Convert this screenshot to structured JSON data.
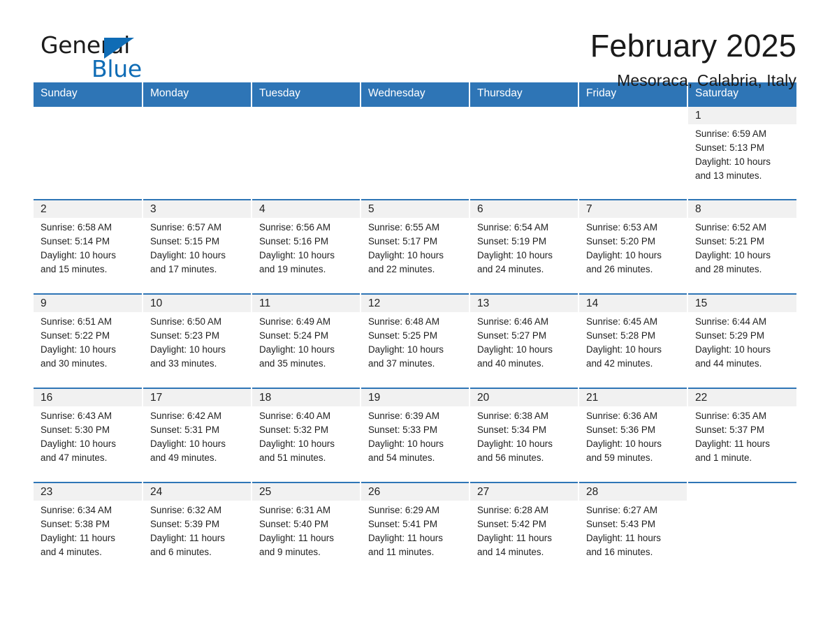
{
  "brand": {
    "word_one": "General",
    "word_two": "Blue",
    "accent_color": "#0f6cb5",
    "triangle_icon": "triangle-icon"
  },
  "header": {
    "title": "February 2025",
    "location": "Mesoraca, Calabria, Italy"
  },
  "theme": {
    "header_blue": "#2e75b6",
    "daynum_band": "#f1f1f1",
    "text": "#1f1f1f"
  },
  "calendar": {
    "weekday_headers": [
      "Sunday",
      "Monday",
      "Tuesday",
      "Wednesday",
      "Thursday",
      "Friday",
      "Saturday"
    ],
    "weeks": [
      [
        {
          "day": "",
          "empty": true
        },
        {
          "day": "",
          "empty": true
        },
        {
          "day": "",
          "empty": true
        },
        {
          "day": "",
          "empty": true
        },
        {
          "day": "",
          "empty": true
        },
        {
          "day": "",
          "empty": true
        },
        {
          "day": "1",
          "sunrise": "Sunrise: 6:59 AM",
          "sunset": "Sunset: 5:13 PM",
          "daylight_1": "Daylight: 10 hours",
          "daylight_2": "and 13 minutes."
        }
      ],
      [
        {
          "day": "2",
          "sunrise": "Sunrise: 6:58 AM",
          "sunset": "Sunset: 5:14 PM",
          "daylight_1": "Daylight: 10 hours",
          "daylight_2": "and 15 minutes."
        },
        {
          "day": "3",
          "sunrise": "Sunrise: 6:57 AM",
          "sunset": "Sunset: 5:15 PM",
          "daylight_1": "Daylight: 10 hours",
          "daylight_2": "and 17 minutes."
        },
        {
          "day": "4",
          "sunrise": "Sunrise: 6:56 AM",
          "sunset": "Sunset: 5:16 PM",
          "daylight_1": "Daylight: 10 hours",
          "daylight_2": "and 19 minutes."
        },
        {
          "day": "5",
          "sunrise": "Sunrise: 6:55 AM",
          "sunset": "Sunset: 5:17 PM",
          "daylight_1": "Daylight: 10 hours",
          "daylight_2": "and 22 minutes."
        },
        {
          "day": "6",
          "sunrise": "Sunrise: 6:54 AM",
          "sunset": "Sunset: 5:19 PM",
          "daylight_1": "Daylight: 10 hours",
          "daylight_2": "and 24 minutes."
        },
        {
          "day": "7",
          "sunrise": "Sunrise: 6:53 AM",
          "sunset": "Sunset: 5:20 PM",
          "daylight_1": "Daylight: 10 hours",
          "daylight_2": "and 26 minutes."
        },
        {
          "day": "8",
          "sunrise": "Sunrise: 6:52 AM",
          "sunset": "Sunset: 5:21 PM",
          "daylight_1": "Daylight: 10 hours",
          "daylight_2": "and 28 minutes."
        }
      ],
      [
        {
          "day": "9",
          "sunrise": "Sunrise: 6:51 AM",
          "sunset": "Sunset: 5:22 PM",
          "daylight_1": "Daylight: 10 hours",
          "daylight_2": "and 30 minutes."
        },
        {
          "day": "10",
          "sunrise": "Sunrise: 6:50 AM",
          "sunset": "Sunset: 5:23 PM",
          "daylight_1": "Daylight: 10 hours",
          "daylight_2": "and 33 minutes."
        },
        {
          "day": "11",
          "sunrise": "Sunrise: 6:49 AM",
          "sunset": "Sunset: 5:24 PM",
          "daylight_1": "Daylight: 10 hours",
          "daylight_2": "and 35 minutes."
        },
        {
          "day": "12",
          "sunrise": "Sunrise: 6:48 AM",
          "sunset": "Sunset: 5:25 PM",
          "daylight_1": "Daylight: 10 hours",
          "daylight_2": "and 37 minutes."
        },
        {
          "day": "13",
          "sunrise": "Sunrise: 6:46 AM",
          "sunset": "Sunset: 5:27 PM",
          "daylight_1": "Daylight: 10 hours",
          "daylight_2": "and 40 minutes."
        },
        {
          "day": "14",
          "sunrise": "Sunrise: 6:45 AM",
          "sunset": "Sunset: 5:28 PM",
          "daylight_1": "Daylight: 10 hours",
          "daylight_2": "and 42 minutes."
        },
        {
          "day": "15",
          "sunrise": "Sunrise: 6:44 AM",
          "sunset": "Sunset: 5:29 PM",
          "daylight_1": "Daylight: 10 hours",
          "daylight_2": "and 44 minutes."
        }
      ],
      [
        {
          "day": "16",
          "sunrise": "Sunrise: 6:43 AM",
          "sunset": "Sunset: 5:30 PM",
          "daylight_1": "Daylight: 10 hours",
          "daylight_2": "and 47 minutes."
        },
        {
          "day": "17",
          "sunrise": "Sunrise: 6:42 AM",
          "sunset": "Sunset: 5:31 PM",
          "daylight_1": "Daylight: 10 hours",
          "daylight_2": "and 49 minutes."
        },
        {
          "day": "18",
          "sunrise": "Sunrise: 6:40 AM",
          "sunset": "Sunset: 5:32 PM",
          "daylight_1": "Daylight: 10 hours",
          "daylight_2": "and 51 minutes."
        },
        {
          "day": "19",
          "sunrise": "Sunrise: 6:39 AM",
          "sunset": "Sunset: 5:33 PM",
          "daylight_1": "Daylight: 10 hours",
          "daylight_2": "and 54 minutes."
        },
        {
          "day": "20",
          "sunrise": "Sunrise: 6:38 AM",
          "sunset": "Sunset: 5:34 PM",
          "daylight_1": "Daylight: 10 hours",
          "daylight_2": "and 56 minutes."
        },
        {
          "day": "21",
          "sunrise": "Sunrise: 6:36 AM",
          "sunset": "Sunset: 5:36 PM",
          "daylight_1": "Daylight: 10 hours",
          "daylight_2": "and 59 minutes."
        },
        {
          "day": "22",
          "sunrise": "Sunrise: 6:35 AM",
          "sunset": "Sunset: 5:37 PM",
          "daylight_1": "Daylight: 11 hours",
          "daylight_2": "and 1 minute."
        }
      ],
      [
        {
          "day": "23",
          "sunrise": "Sunrise: 6:34 AM",
          "sunset": "Sunset: 5:38 PM",
          "daylight_1": "Daylight: 11 hours",
          "daylight_2": "and 4 minutes."
        },
        {
          "day": "24",
          "sunrise": "Sunrise: 6:32 AM",
          "sunset": "Sunset: 5:39 PM",
          "daylight_1": "Daylight: 11 hours",
          "daylight_2": "and 6 minutes."
        },
        {
          "day": "25",
          "sunrise": "Sunrise: 6:31 AM",
          "sunset": "Sunset: 5:40 PM",
          "daylight_1": "Daylight: 11 hours",
          "daylight_2": "and 9 minutes."
        },
        {
          "day": "26",
          "sunrise": "Sunrise: 6:29 AM",
          "sunset": "Sunset: 5:41 PM",
          "daylight_1": "Daylight: 11 hours",
          "daylight_2": "and 11 minutes."
        },
        {
          "day": "27",
          "sunrise": "Sunrise: 6:28 AM",
          "sunset": "Sunset: 5:42 PM",
          "daylight_1": "Daylight: 11 hours",
          "daylight_2": "and 14 minutes."
        },
        {
          "day": "28",
          "sunrise": "Sunrise: 6:27 AM",
          "sunset": "Sunset: 5:43 PM",
          "daylight_1": "Daylight: 11 hours",
          "daylight_2": "and 16 minutes."
        },
        {
          "day": "",
          "empty": true
        }
      ]
    ]
  }
}
